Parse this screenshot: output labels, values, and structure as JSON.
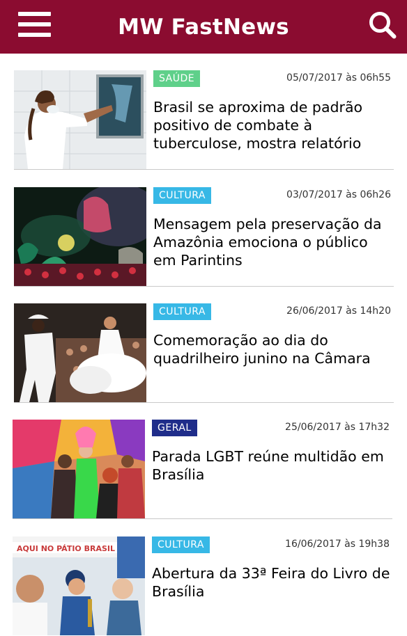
{
  "header": {
    "title": "MW FastNews",
    "background": "#8b0c30",
    "menu_icon": "hamburger-menu-icon",
    "search_icon": "search-icon"
  },
  "category_colors": {
    "SAÚDE": "#5fd08a",
    "CULTURA": "#37b8e6",
    "GERAL": "#1f2d8a"
  },
  "articles": [
    {
      "category": "SAÚDE",
      "date": "05/07/2017 às 06h55",
      "headline": "Brasil se aproxima de padrão positivo de combate à tuberculose, mostra relatório",
      "image": "doctor-examining-xray"
    },
    {
      "category": "CULTURA",
      "date": "03/07/2017 às 06h26",
      "headline": "Mensagem pela preservação da Amazônia emociona o público em Parintins",
      "image": "parintins-festival-stage"
    },
    {
      "category": "CULTURA",
      "date": "26/06/2017 às 14h20",
      "headline": "Comemoração ao dia do quadrilheiro junino na Câmara",
      "image": "quadrilha-dancers"
    },
    {
      "category": "GERAL",
      "date": "25/06/2017 às 17h32",
      "headline": "Parada LGBT reúne multidão em Brasília",
      "image": "lgbt-parade-crowd"
    },
    {
      "category": "CULTURA",
      "date": "16/06/2017 às 19h38",
      "headline": "Abertura da 33ª Feira do Livro de Brasília",
      "image": "book-fair-opening"
    }
  ]
}
